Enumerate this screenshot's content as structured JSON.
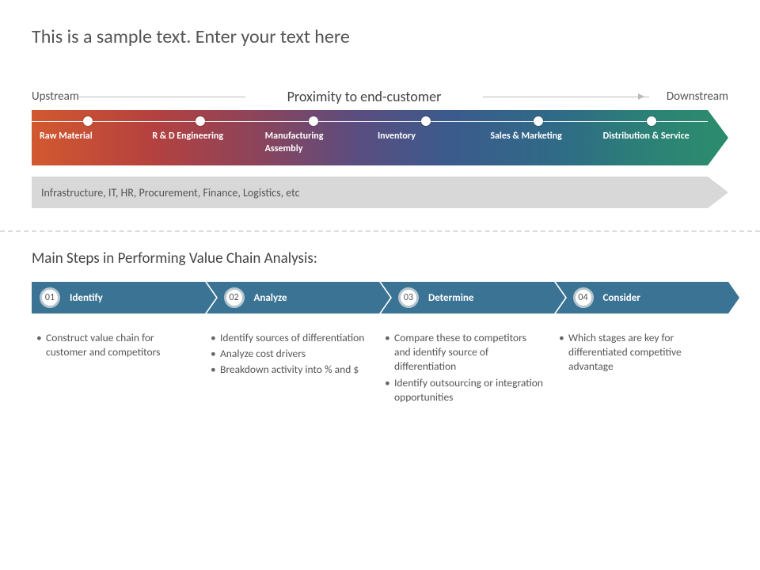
{
  "title": "This is a sample text. Enter your text here",
  "proximity": {
    "left": "Upstream",
    "center": "Proximity to end-customer",
    "right": "Downstream"
  },
  "chain": [
    "Raw Material",
    "R & D Engineering",
    "Manufacturing Assembly",
    "Inventory",
    "Sales & Marketing",
    "Distribution & Service"
  ],
  "support": "Infrastructure, IT, HR, Procurement, Finance, Logistics, etc",
  "subtitle": "Main Steps  in Performing Value Chain Analysis:",
  "steps": [
    {
      "num": "01",
      "label": "Identify",
      "bullets": [
        "Construct value chain for customer and competitors"
      ]
    },
    {
      "num": "02",
      "label": "Analyze",
      "bullets": [
        "Identify sources of differentiation",
        "Analyze cost drivers",
        "Breakdown activity into % and $"
      ]
    },
    {
      "num": "03",
      "label": "Determine",
      "bullets": [
        "Compare these to competitors and identify source of differentiation",
        "Identify outsourcing or integration opportunities"
      ]
    },
    {
      "num": "04",
      "label": "Consider",
      "bullets": [
        "Which stages are key for differentiated competitive advantage"
      ]
    }
  ]
}
